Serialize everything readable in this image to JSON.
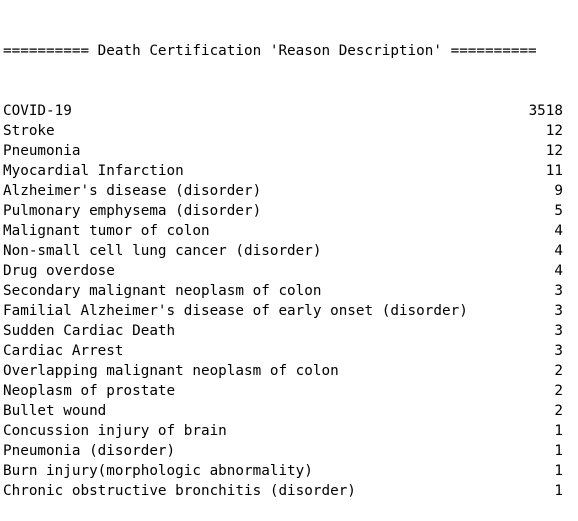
{
  "header": "========== Death Certification 'Reason Description' ==========",
  "rows": [
    {
      "reason": "COVID-19",
      "count": "3518"
    },
    {
      "reason": "Stroke",
      "count": "12"
    },
    {
      "reason": "Pneumonia",
      "count": "12"
    },
    {
      "reason": "Myocardial Infarction",
      "count": "11"
    },
    {
      "reason": "Alzheimer's disease (disorder)",
      "count": "9"
    },
    {
      "reason": "Pulmonary emphysema (disorder)",
      "count": "5"
    },
    {
      "reason": "Malignant tumor of colon",
      "count": "4"
    },
    {
      "reason": "Non-small cell lung cancer (disorder)",
      "count": "4"
    },
    {
      "reason": "Drug overdose",
      "count": "4"
    },
    {
      "reason": "Secondary malignant neoplasm of colon",
      "count": "3"
    },
    {
      "reason": "Familial Alzheimer's disease of early onset (disorder)",
      "count": "3"
    },
    {
      "reason": "Sudden Cardiac Death",
      "count": "3"
    },
    {
      "reason": "Cardiac Arrest",
      "count": "3"
    },
    {
      "reason": "Overlapping malignant neoplasm of colon",
      "count": "2"
    },
    {
      "reason": "Neoplasm of prostate",
      "count": "2"
    },
    {
      "reason": "Bullet wound",
      "count": "2"
    },
    {
      "reason": "Concussion injury of brain",
      "count": "1"
    },
    {
      "reason": "Pneumonia (disorder)",
      "count": "1"
    },
    {
      "reason": "Burn injury(morphologic abnormality)",
      "count": "1"
    },
    {
      "reason": "Chronic obstructive bronchitis (disorder)",
      "count": "1"
    }
  ]
}
